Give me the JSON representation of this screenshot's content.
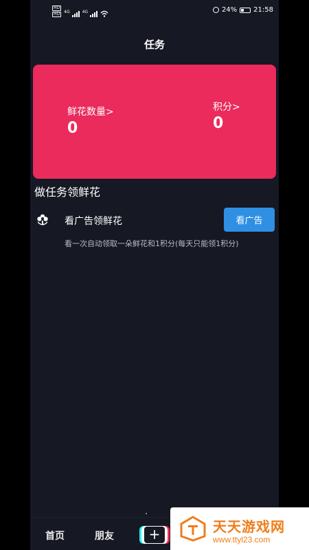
{
  "status_bar": {
    "hd_1": "HD",
    "hd_2": "HD",
    "net_1": "4G",
    "net_2": "4G",
    "battery": "24%",
    "time": "21:58"
  },
  "header": {
    "title": "任务"
  },
  "stats": {
    "flowers_label": "鲜花数量>",
    "flowers_value": "0",
    "points_label": "积分>",
    "points_value": "0"
  },
  "section": {
    "title": "做任务领鲜花"
  },
  "task": {
    "icon": "flower-icon",
    "title": "看广告领鲜花",
    "button_label": "看广告",
    "description": "看一次自动领取一朵鲜花和1积分(每天只能领1积分)"
  },
  "bottom_nav": {
    "home": "首页",
    "friends": "朋友",
    "plus": "+"
  },
  "watermark": {
    "title": "天天游戏网",
    "url": "www.ttyl23.com"
  },
  "colors": {
    "background": "#161823",
    "card": "#ea2b5c",
    "button": "#2f8fe3",
    "watermark": "#f07c1a"
  }
}
